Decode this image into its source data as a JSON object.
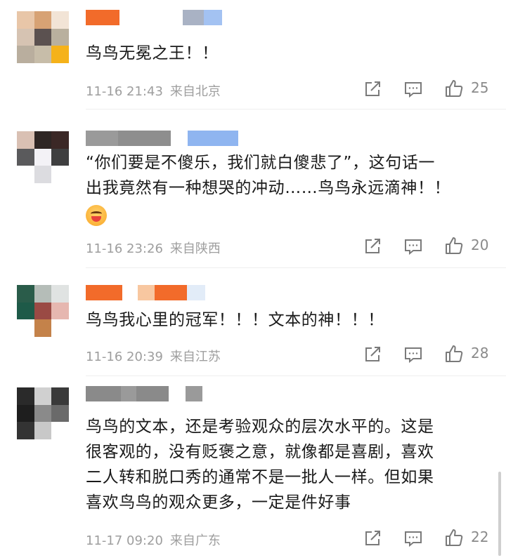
{
  "comments": [
    {
      "text_lines": [
        "鸟鸟无冕之王！！"
      ],
      "time": "11-16 21:43",
      "location": "来自北京",
      "likes": "25",
      "avatar_colors": [
        "#e8c6a8",
        "#d7a274",
        "#f2e4d6",
        "#d6c3b2",
        "#5b5150",
        "#b9b09e",
        "#b9ae9e",
        "#c7bda9",
        "#f5b21a"
      ],
      "name_colors": [
        "#f26b2a",
        "#ffffff",
        "#a9b2c4",
        "#a3c2f2"
      ]
    },
    {
      "text_lines": [
        "“你们要是不傻乐，我们就白傻悲了”，这句话一",
        "出我竟然有一种想哭的冲动……鸟鸟永远滴神！！"
      ],
      "has_emoji": true,
      "emoji_name": "laughing-tears-emoji",
      "time": "11-16 23:26",
      "location": "来自陕西",
      "likes": "20",
      "avatar_colors": [
        "#d9c0b3",
        "#2e2624",
        "#3b2826",
        "#5a5a5c",
        "#f3f2f6",
        "#3f3f40",
        "#ffffff",
        "#dcdce0",
        "#ffffff"
      ],
      "name_colors": [
        "#9a9a9a",
        "#8e8e8e",
        "#ffffff",
        "#8fb5f0"
      ]
    },
    {
      "text_lines": [
        "鸟鸟我心里的冠军！！！文本的神！！！"
      ],
      "time": "11-16 20:39",
      "location": "来自江苏",
      "likes": "28",
      "avatar_colors": [
        "#2a5c4a",
        "#b5bdb8",
        "#e0e3e2",
        "#1e5a48",
        "#9a4a44",
        "#e6b7b0",
        "#ffffff",
        "#c4824a",
        "#ffffff"
      ],
      "name_colors": [
        "#f26b2a",
        "#ffffff",
        "#f8c7a0",
        "#f26b2a",
        "#e2ecf8"
      ]
    },
    {
      "text_lines": [
        "鸟鸟的文本，还是考验观众的层次水平的。这是",
        "很客观的，没有贬褒之意，就像都是喜剧，喜欢",
        "二人转和脱口秀的通常不是一批人一样。但如果",
        "喜欢鸟鸟的观众更多，一定是件好事"
      ],
      "time": "11-17 09:20",
      "location": "来自广东",
      "likes": "22",
      "avatar_colors": [
        "#2a2a2a",
        "#d0d0d0",
        "#3a3a3a",
        "#1e1e1e",
        "#8a8a8a",
        "#6a6a6a",
        "#333333",
        "#c8c8c8",
        "#ffffff"
      ],
      "name_colors": [
        "#8a8a8a",
        "#9a9a9a",
        "#8a8a8a",
        "#ffffff",
        "#9a9a9a"
      ]
    }
  ]
}
